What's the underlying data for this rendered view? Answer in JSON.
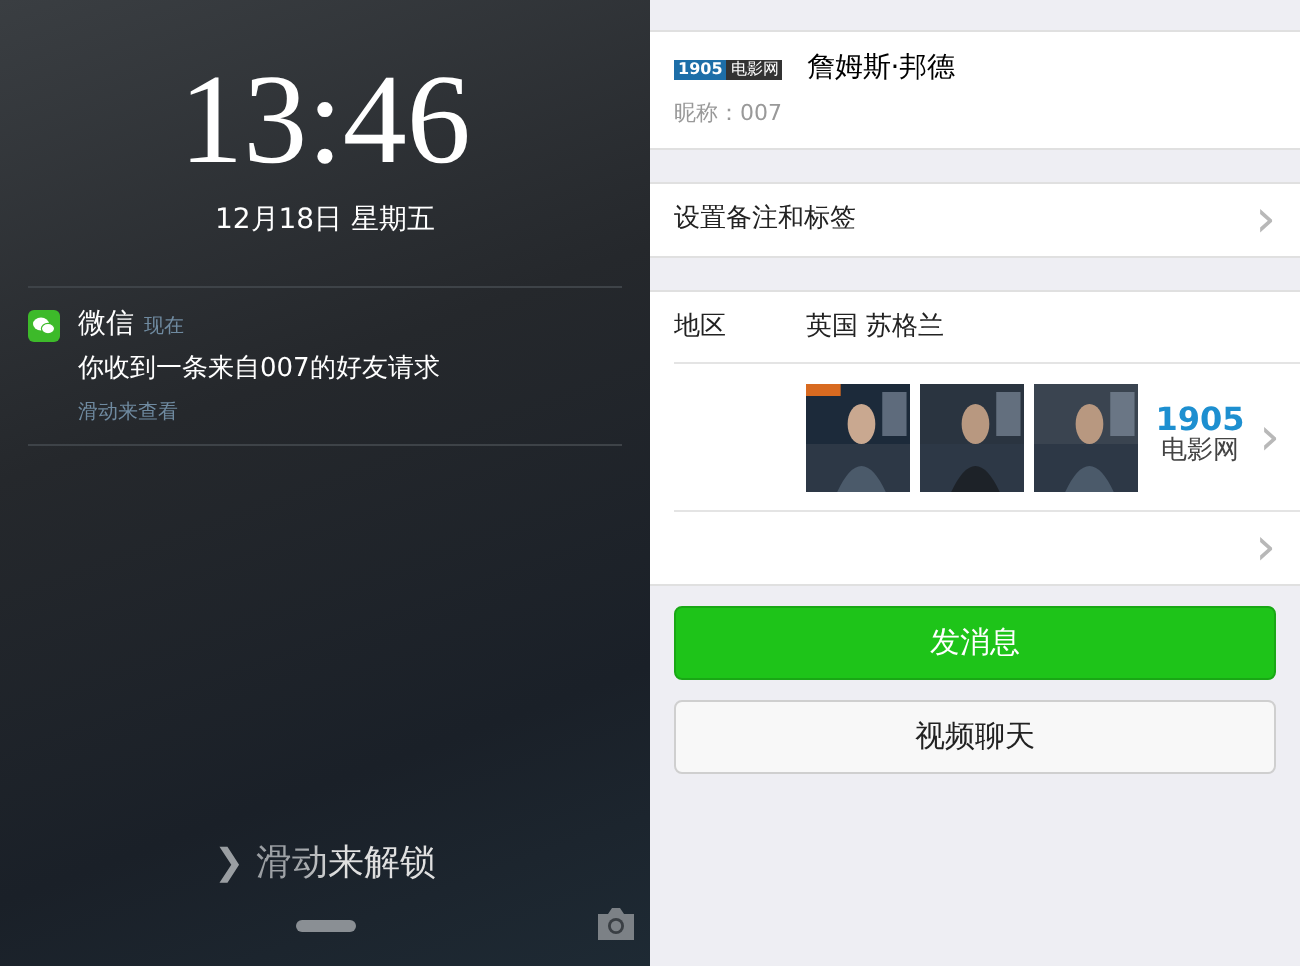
{
  "lock_screen": {
    "time": "13:46",
    "date": "12月18日 星期五",
    "notification": {
      "app": "微信",
      "when": "现在",
      "message": "你收到一条来自007的好友请求",
      "hint": "滑动来查看"
    },
    "unlock": {
      "arrow": "❯",
      "label": "滑动来解锁"
    }
  },
  "profile": {
    "avatar_logo": {
      "number": "1905",
      "text": "电影网"
    },
    "name": "詹姆斯·邦德",
    "nickname": "昵称：007",
    "remark_row": {
      "label": "设置备注和标签",
      "chevron": "›"
    },
    "region": {
      "label": "地区",
      "value": "英国 苏格兰"
    },
    "album": {
      "logo": {
        "number": "1905",
        "text": "电影网"
      },
      "chevron": "›"
    },
    "more_row": {
      "chevron": "›"
    },
    "buttons": [
      {
        "label": "发消息",
        "kind": "primary"
      },
      {
        "label": "视频聊天",
        "kind": "secondary"
      }
    ]
  }
}
